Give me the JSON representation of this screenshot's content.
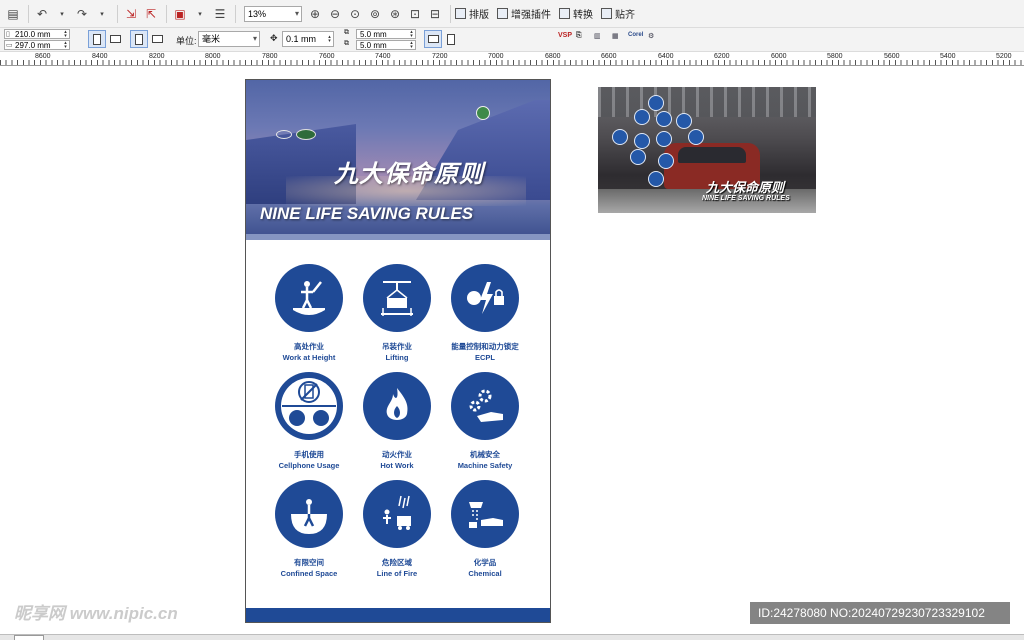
{
  "toolbar": {
    "zoom": "13%",
    "menus": [
      "排版",
      "增强插件",
      "转换",
      "贴齐"
    ]
  },
  "property_bar": {
    "width": "210.0 mm",
    "height": "297.0 mm",
    "units_label": "单位:",
    "units_value": "毫米",
    "nudge": "0.1 mm",
    "dup_x": "5.0 mm",
    "dup_y": "5.0 mm",
    "vsp_label": "VSP",
    "corel_label": "Corel"
  },
  "ruler": {
    "labels": [
      "8600",
      "8400",
      "8200",
      "8000",
      "7800",
      "7600",
      "7400",
      "7200",
      "7000",
      "6800",
      "6600",
      "6400",
      "6200",
      "6000",
      "5800",
      "5600",
      "5400",
      "5200"
    ]
  },
  "poster": {
    "title_cn": "九大保命原则",
    "title_en": "NINE LIFE SAVING RULES",
    "rules": [
      {
        "cn": "高处作业",
        "en": "Work at Height",
        "icon": "work-at-height-icon"
      },
      {
        "cn": "吊装作业",
        "en": "Lifting",
        "icon": "lifting-icon"
      },
      {
        "cn": "能量控制和动力锁定",
        "en": "ECPL",
        "icon": "ecpl-icon"
      },
      {
        "cn": "手机使用",
        "en": "Cellphone Usage",
        "icon": "cellphone-icon"
      },
      {
        "cn": "动火作业",
        "en": "Hot Work",
        "icon": "hot-work-icon"
      },
      {
        "cn": "机械安全",
        "en": "Machine Safety",
        "icon": "machine-safety-icon"
      },
      {
        "cn": "有限空间",
        "en": "Confined Space",
        "icon": "confined-space-icon"
      },
      {
        "cn": "危险区域",
        "en": "Line of Fire",
        "icon": "line-of-fire-icon"
      },
      {
        "cn": "化学品",
        "en": "Chemical",
        "icon": "chemical-icon"
      }
    ]
  },
  "thumbnail": {
    "title_cn": "九大保命原则",
    "title_en": "NINE LIFE SAVING RULES"
  },
  "watermarks": {
    "site": "昵享网 www.nipic.cn",
    "id": "ID:24278080 NO:20240729230723329102"
  },
  "colors": {
    "brand_blue": "#1f4a96",
    "toolbar_bg": "#f3f3f3"
  }
}
